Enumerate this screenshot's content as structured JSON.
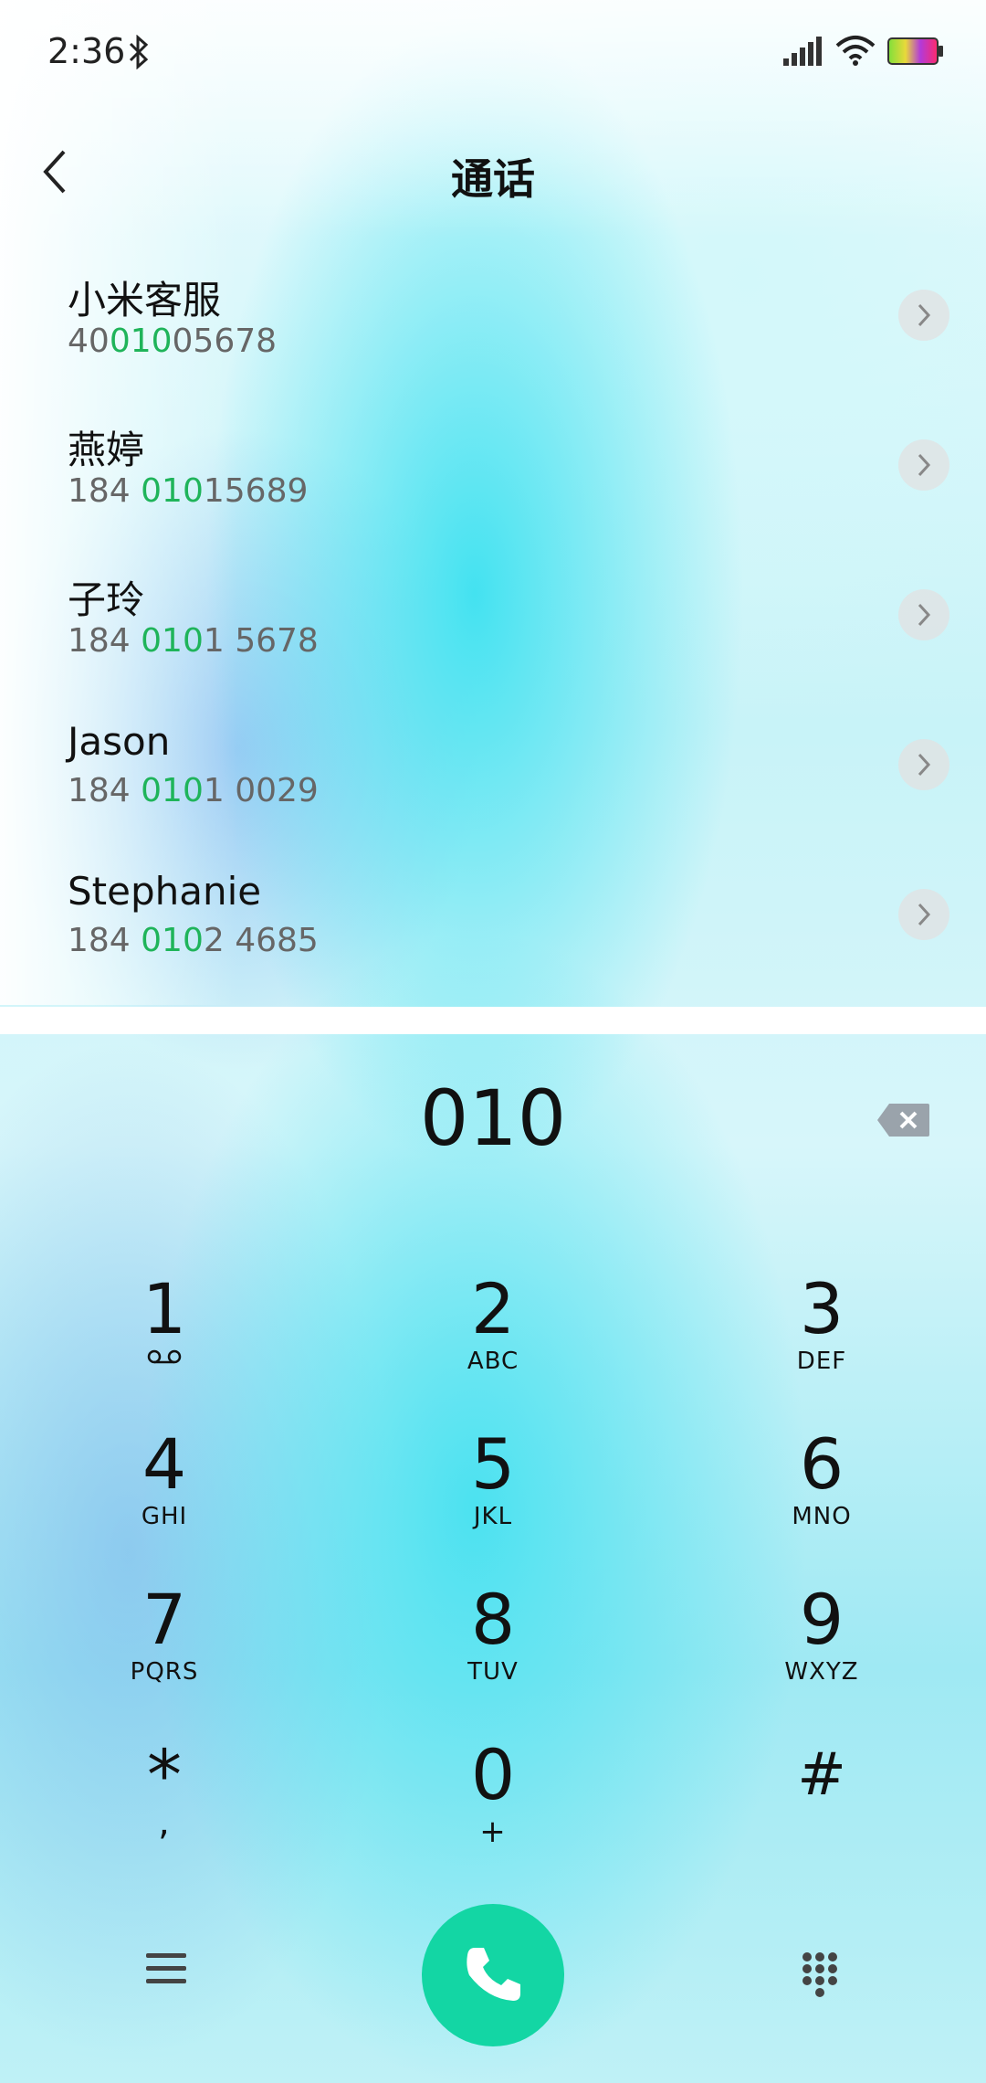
{
  "status_bar": {
    "time": "2:36"
  },
  "header": {
    "title": "通话"
  },
  "contacts": [
    {
      "name": "小米客服",
      "num_pre": "40",
      "num_match": "010",
      "num_post": "05678"
    },
    {
      "name": "燕婷",
      "num_pre": "184 ",
      "num_match": "010",
      "num_post": "15689"
    },
    {
      "name": "子玲",
      "num_pre": "184 ",
      "num_match": "010",
      "num_post": "1 5678"
    },
    {
      "name": "Jason",
      "num_pre": "184 ",
      "num_match": "010",
      "num_post": "1 0029"
    },
    {
      "name": "Stephanie",
      "num_pre": "184 ",
      "num_match": "010",
      "num_post": "2 4685"
    }
  ],
  "dialer": {
    "input": "010"
  },
  "keys": [
    {
      "digit": "1",
      "letters": ""
    },
    {
      "digit": "2",
      "letters": "ABC"
    },
    {
      "digit": "3",
      "letters": "DEF"
    },
    {
      "digit": "4",
      "letters": "GHI"
    },
    {
      "digit": "5",
      "letters": "JKL"
    },
    {
      "digit": "6",
      "letters": "MNO"
    },
    {
      "digit": "7",
      "letters": "PQRS"
    },
    {
      "digit": "8",
      "letters": "TUV"
    },
    {
      "digit": "9",
      "letters": "WXYZ"
    },
    {
      "digit": "*",
      "letters": ","
    },
    {
      "digit": "0",
      "letters": "+"
    },
    {
      "digit": "#",
      "letters": ""
    }
  ],
  "icons": {
    "back": "chevron-left-icon",
    "row_action": "chevron-right-icon",
    "delete": "backspace-icon",
    "voicemail": "voicemail-icon",
    "menu": "menu-icon",
    "call": "phone-icon",
    "keypad": "keypad-icon"
  },
  "colors": {
    "match_highlight": "#1fb45a",
    "call_button": "#13d6a4"
  }
}
